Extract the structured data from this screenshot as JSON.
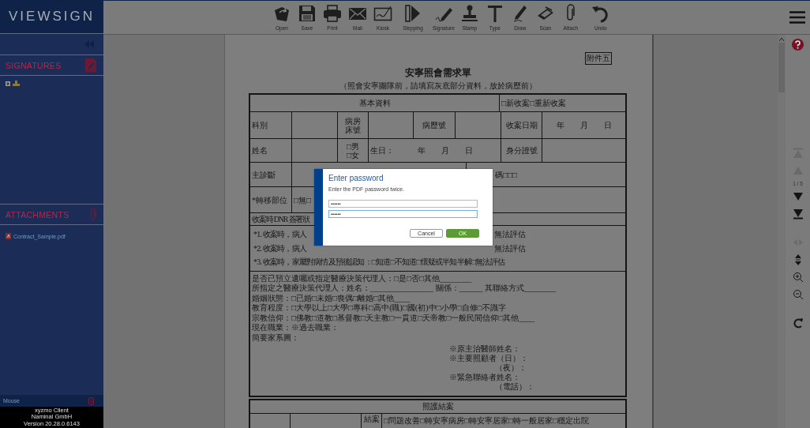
{
  "sidebar": {
    "logo": "VIEWSIGN",
    "sections": [
      {
        "title": "SIGNATURES",
        "kind": "signatures"
      },
      {
        "title": "ATTACHMENTS",
        "kind": "attachments"
      }
    ],
    "attachments": [
      {
        "name": "Contract_Sample.pdf"
      }
    ],
    "input_device": "Mouse",
    "footer": [
      "xyzmo Client",
      "Naminal GmbH",
      "Version 20.28.0.6143"
    ]
  },
  "toolbar": [
    {
      "label": "Open",
      "kind": "open"
    },
    {
      "label": "Save",
      "kind": "save"
    },
    {
      "label": "Print",
      "kind": "print"
    },
    {
      "label": "Mail",
      "kind": "mail"
    },
    {
      "label": "Kiosk",
      "kind": "kiosk"
    },
    {
      "label": "Stepping",
      "kind": "stepping"
    },
    {
      "label": "Signature",
      "kind": "signature"
    },
    {
      "label": "Stamp",
      "kind": "stamp"
    },
    {
      "label": "Type",
      "kind": "type"
    },
    {
      "label": "Draw",
      "kind": "draw"
    },
    {
      "label": "Scan",
      "kind": "scan"
    },
    {
      "label": "Attach",
      "kind": "attach"
    },
    {
      "label": "Undo",
      "kind": "undo"
    }
  ],
  "document": {
    "annex": "附件五",
    "title": "安寧照會需求單",
    "subtitle": "（照會安寧團隊前，請填寫灰底部分資料，放於病歷前）",
    "basic_header": "基本資料",
    "case_type": "□新收案□重新收案",
    "row_1": [
      "科別",
      "病房床號",
      "病歷號",
      "收案日期",
      "年　　月　　日"
    ],
    "row_2": [
      "姓名",
      "□男□女",
      "生日：　　　年　　月　　日",
      "身分證號"
    ],
    "row_3": [
      "主診斷",
      "碼□□□"
    ],
    "row_4": [
      "*轉移部位",
      "□無□"
    ],
    "dnr_title": "收案時 DNR 簽署狀",
    "dnr_items": [
      {
        "left": "*1. 收案時，病人",
        "right": "無法評估"
      },
      {
        "left": "*2. 收案時，病人",
        "right": "無法評估"
      },
      {
        "left": "*3. 收案時，家屬對病情及預後認知：□知道□不知道□懷疑或半知半解□無法評估"
      }
    ],
    "lines": [
      "是否已預立遺囑或指定醫療決策代理人：□是□否□其他________",
      "所指定之醫療決策代理人：姓名：________________ 關係：______ 其聯絡方式________",
      "婚姻狀態：□已婚□未婚□喪偶□離婚□其他____",
      "教育程度：□大學以上□大學□專科□高中(職)□國(初)中□小學□自修□不識字",
      "宗教信仰：□佛教□道教□基督教□天主教□一貫道□天帝教□一般民間信仰□其他____",
      "現在職業：※過去職業：",
      "簡要家系圖："
    ],
    "contacts": [
      "※原主治醫師姓名：",
      "※主要照顧者（日）：",
      "（夜）：",
      "※緊急聯絡者姓名：",
      "（電話）："
    ],
    "closing_header": "照護結案",
    "closing_label": "結案",
    "closing_options": "□問題改善□轉安寧病房□轉安寧居家□轉一般居家□穩定出院"
  },
  "navigation": [
    {
      "kind": "first",
      "disabled": true
    },
    {
      "kind": "previous",
      "disabled": true
    },
    {
      "kind": "page",
      "text": "1 / 5"
    },
    {
      "kind": "next",
      "disabled": false
    },
    {
      "kind": "last",
      "disabled": false
    },
    {
      "kind": "pan",
      "disabled": true
    },
    {
      "kind": "fit",
      "disabled": false
    },
    {
      "kind": "zoom-in",
      "disabled": false
    },
    {
      "kind": "zoom-out",
      "disabled": false
    },
    {
      "kind": "rotate",
      "disabled": false
    }
  ],
  "dialog": {
    "title": "Enter password",
    "message": "Enter the PDF password twice.",
    "fields": [
      {
        "value": "••••••",
        "focused": false
      },
      {
        "value": "••••••",
        "focused": true
      }
    ],
    "buttons": [
      {
        "label": "Cancel",
        "kind": "secondary"
      },
      {
        "label": "OK",
        "kind": "primary"
      }
    ]
  }
}
